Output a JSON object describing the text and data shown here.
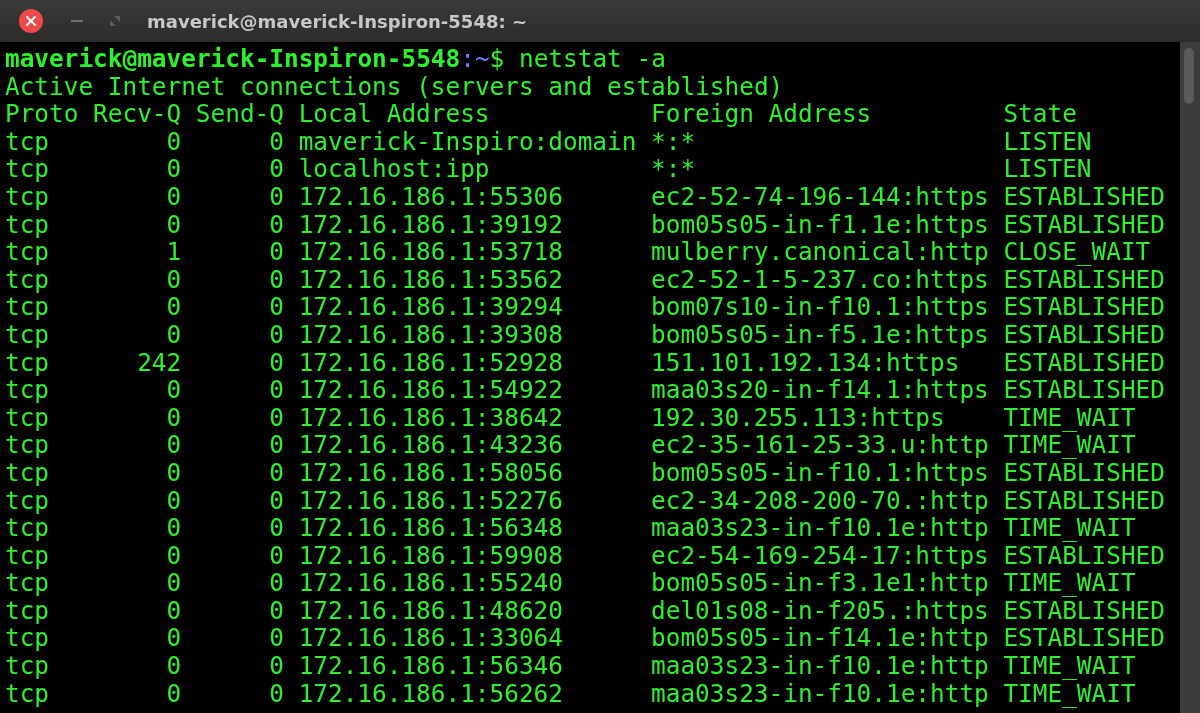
{
  "window": {
    "title": "maverick@maverick-Inspiron-5548: ~"
  },
  "prompt": {
    "user_host": "maverick@maverick-Inspiron-5548",
    "separator": ":",
    "path": "~",
    "symbol": "$",
    "command": " netstat -a"
  },
  "intro": "Active Internet connections (servers and established)",
  "table": {
    "columns": [
      "Proto",
      "Recv-Q",
      "Send-Q",
      "Local Address",
      "Foreign Address",
      "State"
    ],
    "rows": [
      [
        "tcp",
        "0",
        "0",
        "maverick-Inspiro:domain",
        "*:*",
        "LISTEN"
      ],
      [
        "tcp",
        "0",
        "0",
        "localhost:ipp",
        "*:*",
        "LISTEN"
      ],
      [
        "tcp",
        "0",
        "0",
        "172.16.186.1:55306",
        "ec2-52-74-196-144:https",
        "ESTABLISHED"
      ],
      [
        "tcp",
        "0",
        "0",
        "172.16.186.1:39192",
        "bom05s05-in-f1.1e:https",
        "ESTABLISHED"
      ],
      [
        "tcp",
        "1",
        "0",
        "172.16.186.1:53718",
        "mulberry.canonical:http",
        "CLOSE_WAIT"
      ],
      [
        "tcp",
        "0",
        "0",
        "172.16.186.1:53562",
        "ec2-52-1-5-237.co:https",
        "ESTABLISHED"
      ],
      [
        "tcp",
        "0",
        "0",
        "172.16.186.1:39294",
        "bom07s10-in-f10.1:https",
        "ESTABLISHED"
      ],
      [
        "tcp",
        "0",
        "0",
        "172.16.186.1:39308",
        "bom05s05-in-f5.1e:https",
        "ESTABLISHED"
      ],
      [
        "tcp",
        "242",
        "0",
        "172.16.186.1:52928",
        "151.101.192.134:https",
        "ESTABLISHED"
      ],
      [
        "tcp",
        "0",
        "0",
        "172.16.186.1:54922",
        "maa03s20-in-f14.1:https",
        "ESTABLISHED"
      ],
      [
        "tcp",
        "0",
        "0",
        "172.16.186.1:38642",
        "192.30.255.113:https",
        "TIME_WAIT"
      ],
      [
        "tcp",
        "0",
        "0",
        "172.16.186.1:43236",
        "ec2-35-161-25-33.u:http",
        "TIME_WAIT"
      ],
      [
        "tcp",
        "0",
        "0",
        "172.16.186.1:58056",
        "bom05s05-in-f10.1:https",
        "ESTABLISHED"
      ],
      [
        "tcp",
        "0",
        "0",
        "172.16.186.1:52276",
        "ec2-34-208-200-70.:http",
        "ESTABLISHED"
      ],
      [
        "tcp",
        "0",
        "0",
        "172.16.186.1:56348",
        "maa03s23-in-f10.1e:http",
        "TIME_WAIT"
      ],
      [
        "tcp",
        "0",
        "0",
        "172.16.186.1:59908",
        "ec2-54-169-254-17:https",
        "ESTABLISHED"
      ],
      [
        "tcp",
        "0",
        "0",
        "172.16.186.1:55240",
        "bom05s05-in-f3.1e1:http",
        "TIME_WAIT"
      ],
      [
        "tcp",
        "0",
        "0",
        "172.16.186.1:48620",
        "del01s08-in-f205.:https",
        "ESTABLISHED"
      ],
      [
        "tcp",
        "0",
        "0",
        "172.16.186.1:33064",
        "bom05s05-in-f14.1e:http",
        "ESTABLISHED"
      ],
      [
        "tcp",
        "0",
        "0",
        "172.16.186.1:56346",
        "maa03s23-in-f10.1e:http",
        "TIME_WAIT"
      ],
      [
        "tcp",
        "0",
        "0",
        "172.16.186.1:56262",
        "maa03s23-in-f10.1e:http",
        "TIME_WAIT"
      ]
    ]
  }
}
